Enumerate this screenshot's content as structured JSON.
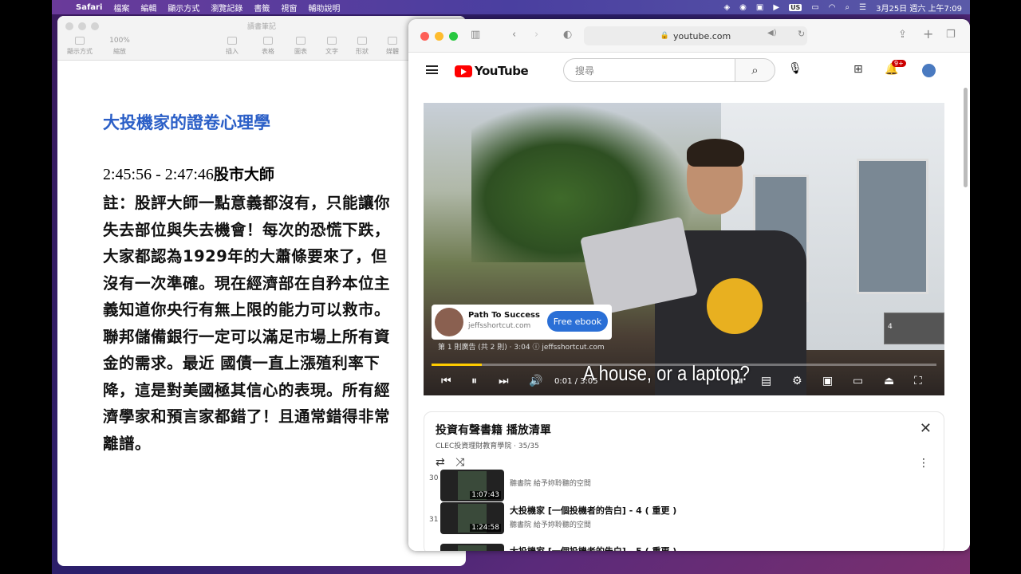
{
  "menubar": {
    "app": "Safari",
    "items": [
      "檔案",
      "編輯",
      "顯示方式",
      "瀏覽記錄",
      "書籤",
      "視窗",
      "輔助說明"
    ],
    "date_time": "3月25日 週六 上午7:09",
    "input_badge": "US"
  },
  "pages": {
    "window_title": "讀書筆記",
    "zoom": "100%",
    "toolbar": [
      "顯示方式",
      "縮放",
      "插入",
      "表格",
      "圖表",
      "文字",
      "形狀",
      "媒體"
    ],
    "doc_title": "大投機家的證卷心理學",
    "timestamp": "2:45:56 - 2:47:46",
    "section_label": "股市大師",
    "body": "註：股評大師一點意義都沒有，只能讓你失去部位與失去機會！每次的恐慌下跌，大家都認為1929年的大蕭條要來了，但沒有一次準確。現在經濟部在自矜本位主義知道你央行有無上限的能力可以救市。聯邦儲備銀行一定可以滿足市場上所有資金的需求。最近 國債一直上漲殖利率下降，這是對美國極其信心的表現。所有經濟學家和預言家都錯了！且通常錯得非常離譜。"
  },
  "safari": {
    "url": "youtube.com"
  },
  "youtube": {
    "logo_text": "YouTube",
    "search_placeholder": "搜尋",
    "notification_count": "9+",
    "video": {
      "caption": "A house, or a laptop?",
      "time": "0:01 / 3:05",
      "progress": 0.1,
      "ad": {
        "name": "Path To Success",
        "url": "jeffsshortcut.com",
        "button": "Free ebook",
        "info": "第 1 則廣告 (共 2 則) · 3:04",
        "info_url": "jeffsshortcut.com"
      },
      "next_thumb_num": "4"
    },
    "playlist": {
      "title": "投資有聲書籍 播放清單",
      "channel": "CLEC投資理財教育學院",
      "position": "35/35",
      "items": [
        {
          "num": "30",
          "title": "",
          "channel": "聽書院 給予妳聆聽的空間",
          "duration": "1:07:43"
        },
        {
          "num": "31",
          "title": "大投機家 [一個投機者的告白] - 4 ( 重更 )",
          "channel": "聽書院 給予妳聆聽的空間",
          "duration": "1:24:58"
        },
        {
          "num": "",
          "title": "大投機家 [一個投機者的告白] - 5 ( 重更 )",
          "channel": "",
          "duration": ""
        }
      ]
    }
  }
}
